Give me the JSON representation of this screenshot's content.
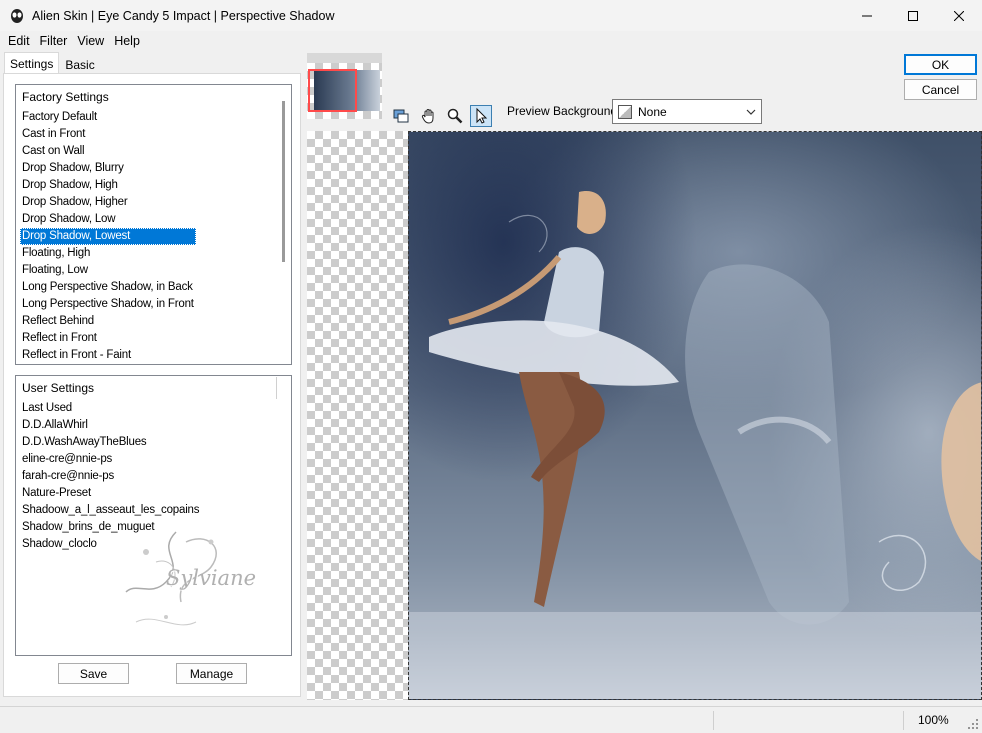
{
  "window": {
    "title": "Alien Skin | Eye Candy 5 Impact | Perspective Shadow"
  },
  "menu": [
    "Edit",
    "Filter",
    "View",
    "Help"
  ],
  "tabs": [
    {
      "label": "Settings",
      "active": true
    },
    {
      "label": "Basic",
      "active": false
    }
  ],
  "factory_settings": {
    "header": "Factory Settings",
    "items": [
      "Factory Default",
      "Cast in Front",
      "Cast on Wall",
      "Drop Shadow, Blurry",
      "Drop Shadow, High",
      "Drop Shadow, Higher",
      "Drop Shadow, Low",
      "Drop Shadow, Lowest",
      "Floating, High",
      "Floating, Low",
      "Long Perspective Shadow, in Back",
      "Long Perspective Shadow, in Front",
      "Reflect Behind",
      "Reflect in Front",
      "Reflect in Front - Faint"
    ],
    "selected": "Drop Shadow, Lowest"
  },
  "user_settings": {
    "header": "User Settings",
    "items": [
      "Last Used",
      "D.D.AllaWhirl",
      "D.D.WashAwayTheBlues",
      "eline-cre@nnie-ps",
      "farah-cre@nnie-ps",
      "Nature-Preset",
      "Shadoow_a_l_asseaut_les_copains",
      "Shadow_brins_de_muguet",
      "Shadow_cloclo"
    ],
    "watermark": "Sylviane"
  },
  "buttons": {
    "save": "Save",
    "manage": "Manage",
    "ok": "OK",
    "cancel": "Cancel"
  },
  "preview": {
    "background_label": "Preview Background:",
    "background_value": "None",
    "tools": [
      "preview-toggle-icon",
      "hand-icon",
      "zoom-icon",
      "pointer-icon"
    ],
    "active_tool": "pointer-icon"
  },
  "status": {
    "zoom": "100%"
  },
  "colors": {
    "selection": "#0078d7",
    "ok_border": "#0078d7"
  }
}
